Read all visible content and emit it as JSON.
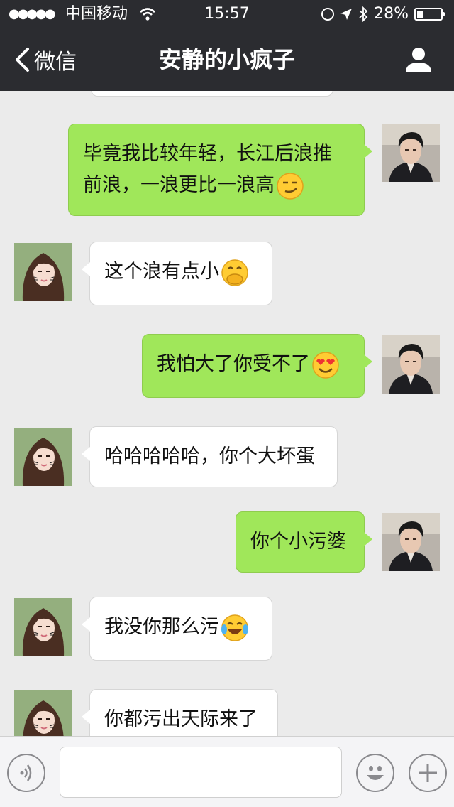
{
  "status_bar": {
    "signal": "●●●●●",
    "carrier": "中国移动",
    "time": "15:57",
    "battery": "28%",
    "battery_level": 0.28,
    "icons": [
      "wifi-icon",
      "orientation-lock-icon",
      "location-icon",
      "bluetooth-icon",
      "battery-icon"
    ]
  },
  "nav": {
    "back_label": "微信",
    "title": "安静的小疯子",
    "icons": [
      "chevron-left-icon",
      "profile-icon"
    ]
  },
  "messages": [
    {
      "side": "right",
      "text_lines": [
        "毕竟我比较年轻，长江后浪推",
        "前浪，一浪更比一浪高"
      ],
      "emoji": "smirk-emoji"
    },
    {
      "side": "left",
      "text_lines": [
        "这个浪有点小"
      ],
      "emoji": "hand-over-mouth-emoji"
    },
    {
      "side": "right",
      "text_lines": [
        "我怕大了你受不了"
      ],
      "emoji": "heart-eyes-emoji"
    },
    {
      "side": "left",
      "text_lines": [
        "哈哈哈哈哈，你个大坏蛋"
      ],
      "emoji": ""
    },
    {
      "side": "right",
      "text_lines": [
        "你个小污婆"
      ],
      "emoji": ""
    },
    {
      "side": "left",
      "text_lines": [
        "我没你那么污"
      ],
      "emoji": "tears-of-joy-emoji"
    },
    {
      "side": "left",
      "text_lines": [
        "你都污出天际来了"
      ],
      "emoji": ""
    }
  ],
  "input_bar": {
    "message_value": "",
    "icons": [
      "voice-icon",
      "emoji-icon",
      "plus-icon"
    ]
  },
  "colors": {
    "nav_bg": "#2b2c30",
    "chat_bg": "#ebebeb",
    "sent_bubble": "#a0e75a",
    "received_bubble": "#ffffff"
  }
}
